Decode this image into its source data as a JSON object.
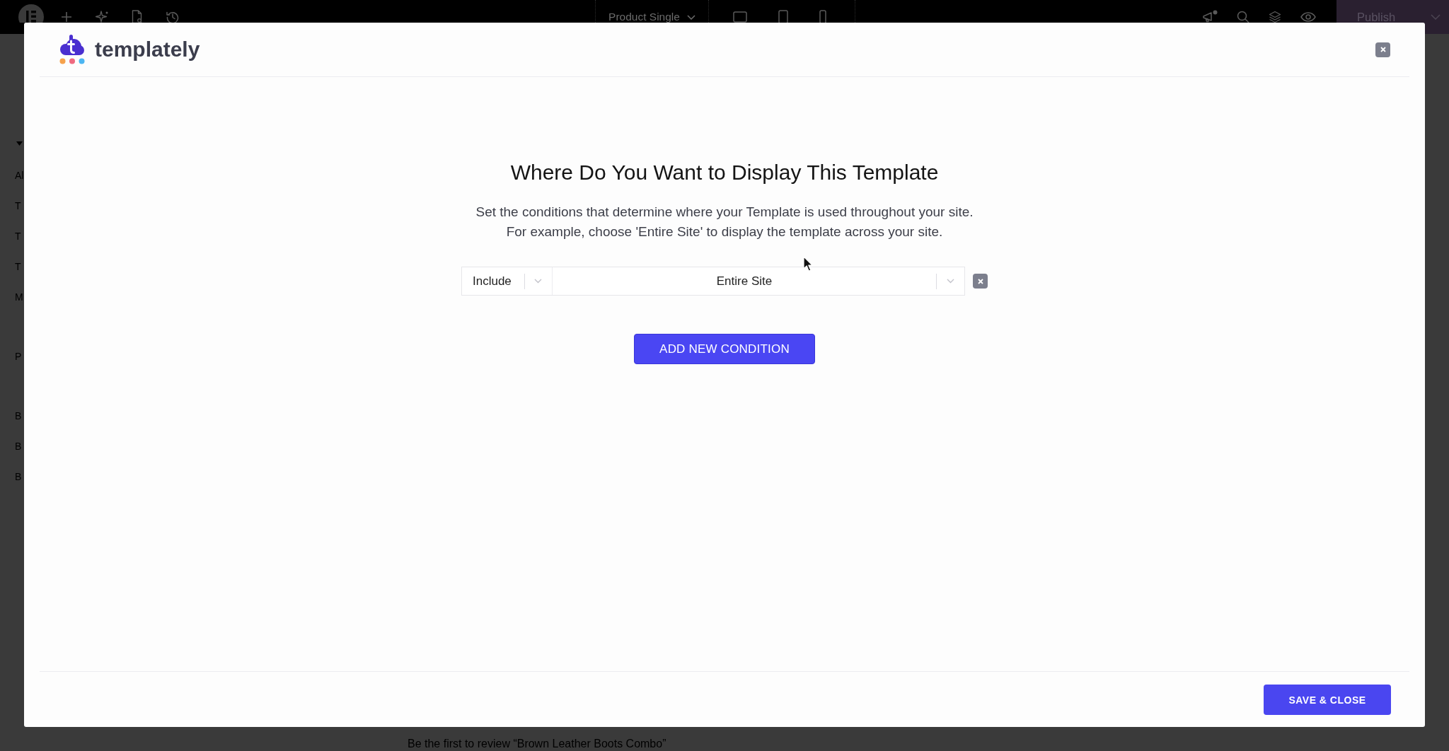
{
  "editor_toolbar": {
    "page_menu": "Product Single",
    "publish_button": "Publish"
  },
  "editor_panel": {
    "expanded": true,
    "sections": [
      [
        "Al",
        "T",
        "T",
        "T",
        "M"
      ],
      [
        "P"
      ],
      [
        "B",
        "B",
        "B"
      ]
    ]
  },
  "page_preview": {
    "review_prompt": "Be the first to review “Brown Leather Boots Combo”"
  },
  "modal": {
    "brand": "templately",
    "title": "Where Do You Want to Display This Template",
    "description_lines": [
      "Set the conditions that determine where your Template is used throughout your site.",
      "For example, choose 'Entire Site' to display the template across your site."
    ],
    "conditions": [
      {
        "mode": "Include",
        "target": "Entire Site"
      }
    ],
    "add_button": "ADD NEW CONDITION",
    "save_button": "SAVE & CLOSE"
  }
}
